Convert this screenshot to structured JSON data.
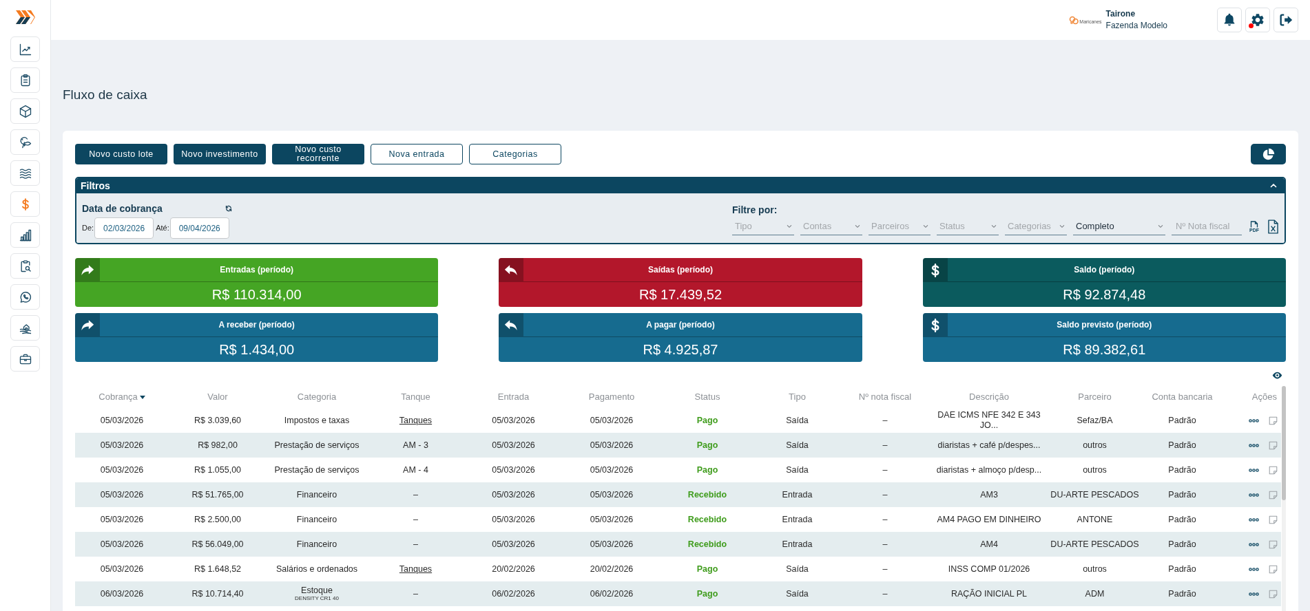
{
  "sidebar": {
    "items": [
      {
        "kind": "chart",
        "selected": false
      },
      {
        "kind": "clipboard",
        "selected": false
      },
      {
        "kind": "box",
        "selected": false
      },
      {
        "kind": "shrimp-fish",
        "selected": false
      },
      {
        "kind": "waves",
        "selected": false
      },
      {
        "kind": "money",
        "selected": true
      },
      {
        "kind": "bars",
        "selected": false
      },
      {
        "kind": "report-search",
        "selected": false
      },
      {
        "kind": "chat",
        "selected": false
      },
      {
        "kind": "farm",
        "selected": false
      },
      {
        "kind": "briefcase",
        "selected": false
      }
    ]
  },
  "header": {
    "logo_text": "Maricanes",
    "user_name": "Tairone",
    "farm_name": "Fazenda Modelo",
    "buttons": [
      {
        "kind": "notifications",
        "alert": false
      },
      {
        "kind": "settings",
        "alert": true
      },
      {
        "kind": "logout",
        "alert": false
      }
    ]
  },
  "page": {
    "title": "Fluxo de caixa"
  },
  "toolbar": {
    "buttons": [
      {
        "label": "Novo custo lote",
        "kind": "primary"
      },
      {
        "label": "Novo investimento",
        "kind": "primary"
      },
      {
        "label": "Novo custo recorrente",
        "kind": "primary"
      },
      {
        "label": "Nova entrada",
        "kind": "outline"
      },
      {
        "label": "Categorias",
        "kind": "outline"
      }
    ]
  },
  "filters": {
    "title": "Filtros",
    "expanded": true,
    "date": {
      "label": "Data de cobrança",
      "from_label": "De:",
      "from": "02/03/2026",
      "to_label": "Até:",
      "to": "09/04/2026"
    },
    "filter_by": {
      "label": "Filtre por:",
      "fields": [
        {
          "kind": "select",
          "placeholder": "Tipo"
        },
        {
          "kind": "select",
          "placeholder": "Contas"
        },
        {
          "kind": "select",
          "placeholder": "Parceiros"
        },
        {
          "kind": "select",
          "placeholder": "Status"
        },
        {
          "kind": "select",
          "placeholder": "Categorias"
        },
        {
          "kind": "select",
          "value": "Completo"
        },
        {
          "kind": "input",
          "placeholder": "Nº Nota fiscal"
        }
      ]
    },
    "exports": [
      {
        "kind": "pdf",
        "label": "PDF"
      },
      {
        "kind": "excel"
      }
    ]
  },
  "summary_cards": [
    {
      "kind": "in",
      "title": "Entradas (período)",
      "value": "R$ 110.314,00",
      "color": "#45a524"
    },
    {
      "kind": "out",
      "title": "Saídas (período)",
      "value": "R$ 17.439,52",
      "color": "#b3172b"
    },
    {
      "kind": "balance",
      "title": "Saldo (período)",
      "value": "R$ 92.874,48",
      "color": "#0b5b5e"
    },
    {
      "kind": "in",
      "title": "A receber (período)",
      "value": "R$ 1.434,00",
      "color": "#166b8f"
    },
    {
      "kind": "out",
      "title": "A pagar (período)",
      "value": "R$ 4.925,87",
      "color": "#166b8f"
    },
    {
      "kind": "balance",
      "title": "Saldo previsto (período)",
      "value": "R$ 89.382,61",
      "color": "#166b8f"
    }
  ],
  "table": {
    "columns": [
      {
        "label": "Cobrança",
        "sorted": true
      },
      {
        "label": "Valor",
        "sorted": false
      },
      {
        "label": "Categoria",
        "sorted": false
      },
      {
        "label": "Tanque",
        "sorted": false
      },
      {
        "label": "Entrada",
        "sorted": false
      },
      {
        "label": "Pagamento",
        "sorted": false
      },
      {
        "label": "Status",
        "sorted": false
      },
      {
        "label": "Tipo",
        "sorted": false
      },
      {
        "label": "Nº nota fiscal",
        "sorted": false
      },
      {
        "label": "Descrição",
        "sorted": false
      },
      {
        "label": "Parceiro",
        "sorted": false
      },
      {
        "label": "Conta bancaria",
        "sorted": false
      },
      {
        "label": "Ações",
        "sorted": false
      }
    ],
    "rows": [
      {
        "cobranca": "05/03/2026",
        "valor": "R$ 3.039,60",
        "categoria": "Impostos e taxas",
        "tanque": {
          "text": "Tanques",
          "link": true
        },
        "entrada": "05/03/2026",
        "pagamento": "05/03/2026",
        "status": "Pago",
        "tipo": "Saída",
        "nota_fiscal": "–",
        "descricao": "DAE ICMS NFE 342 E 343 JO...",
        "parceiro": "Sefaz/BA",
        "conta": "Padrão"
      },
      {
        "cobranca": "05/03/2026",
        "valor": "R$ 982,00",
        "categoria": "Prestação de serviços",
        "tanque": {
          "text": "AM - 3",
          "link": false
        },
        "entrada": "05/03/2026",
        "pagamento": "05/03/2026",
        "status": "Pago",
        "tipo": "Saída",
        "nota_fiscal": "–",
        "descricao": "diaristas + café p/despes...",
        "parceiro": "outros",
        "conta": "Padrão"
      },
      {
        "cobranca": "05/03/2026",
        "valor": "R$ 1.055,00",
        "categoria": "Prestação de serviços",
        "tanque": {
          "text": "AM - 4",
          "link": false
        },
        "entrada": "05/03/2026",
        "pagamento": "05/03/2026",
        "status": "Pago",
        "tipo": "Saída",
        "nota_fiscal": "–",
        "descricao": "diaristas + almoço p/desp...",
        "parceiro": "outros",
        "conta": "Padrão"
      },
      {
        "cobranca": "05/03/2026",
        "valor": "R$ 51.765,00",
        "categoria": "Financeiro",
        "tanque": {
          "text": "–",
          "link": false
        },
        "entrada": "05/03/2026",
        "pagamento": "05/03/2026",
        "status": "Recebido",
        "tipo": "Entrada",
        "nota_fiscal": "–",
        "descricao": "AM3",
        "parceiro": "DU-ARTE PESCADOS",
        "conta": "Padrão"
      },
      {
        "cobranca": "05/03/2026",
        "valor": "R$ 2.500,00",
        "categoria": "Financeiro",
        "tanque": {
          "text": "–",
          "link": false
        },
        "entrada": "05/03/2026",
        "pagamento": "05/03/2026",
        "status": "Recebido",
        "tipo": "Entrada",
        "nota_fiscal": "–",
        "descricao": "AM4 PAGO EM DINHEIRO",
        "parceiro": "ANTONE",
        "conta": "Padrão"
      },
      {
        "cobranca": "05/03/2026",
        "valor": "R$ 56.049,00",
        "categoria": "Financeiro",
        "tanque": {
          "text": "–",
          "link": false
        },
        "entrada": "05/03/2026",
        "pagamento": "05/03/2026",
        "status": "Recebido",
        "tipo": "Entrada",
        "nota_fiscal": "–",
        "descricao": "AM4",
        "parceiro": "DU-ARTE PESCADOS",
        "conta": "Padrão"
      },
      {
        "cobranca": "05/03/2026",
        "valor": "R$ 1.648,52",
        "categoria": "Salários e ordenados",
        "tanque": {
          "text": "Tanques",
          "link": true
        },
        "entrada": "20/02/2026",
        "pagamento": "20/02/2026",
        "status": "Pago",
        "tipo": "Saída",
        "nota_fiscal": "–",
        "descricao": "INSS COMP 01/2026",
        "parceiro": "outros",
        "conta": "Padrão"
      },
      {
        "cobranca": "06/03/2026",
        "valor": "R$ 10.714,40",
        "categoria": "Estoque",
        "categoria_detail": "DENSITY CR1 40",
        "tanque": {
          "text": "–",
          "link": false
        },
        "entrada": "06/02/2026",
        "pagamento": "06/02/2026",
        "status": "Pago",
        "tipo": "Saída",
        "nota_fiscal": "–",
        "descricao": "RAÇÃO INICIAL PL",
        "parceiro": "ADM",
        "conta": "Padrão"
      }
    ]
  }
}
